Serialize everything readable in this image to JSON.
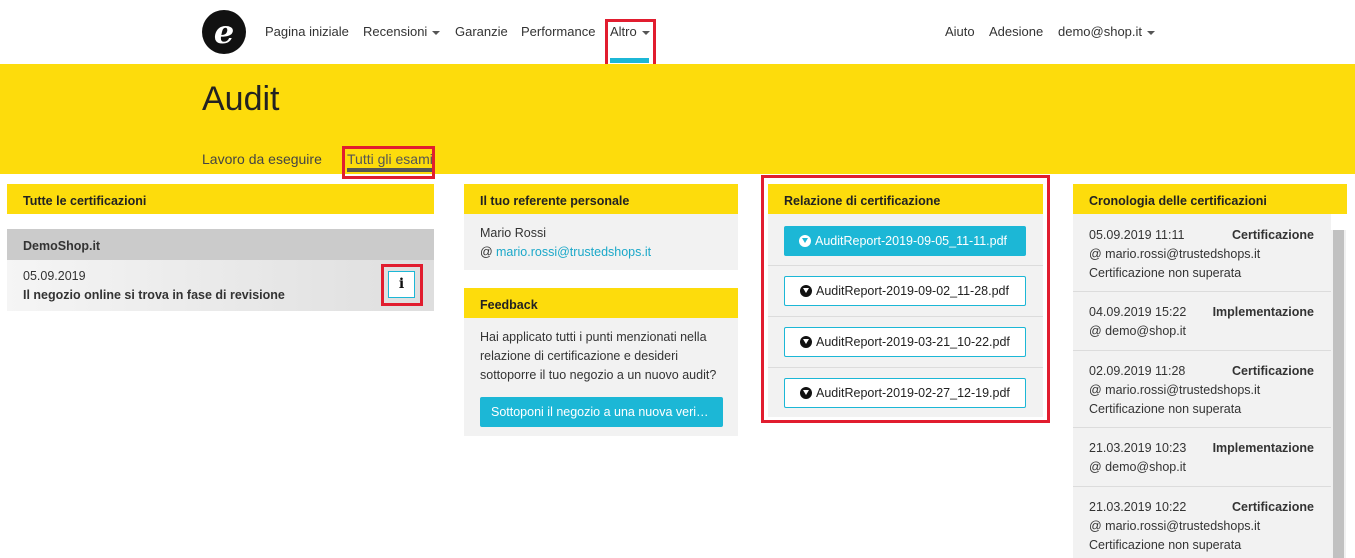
{
  "nav": {
    "logo_letter": "e",
    "items": [
      {
        "label": "Pagina iniziale"
      },
      {
        "label": "Recensioni"
      },
      {
        "label": "Garanzie"
      },
      {
        "label": "Performance"
      },
      {
        "label": "Altro"
      }
    ],
    "right": [
      {
        "label": "Aiuto"
      },
      {
        "label": "Adesione"
      },
      {
        "label": "demo@shop.it"
      }
    ]
  },
  "header": {
    "title": "Audit",
    "tabs": [
      {
        "label": "Lavoro da eseguire"
      },
      {
        "label": "Tutti gli esami"
      }
    ]
  },
  "certifications": {
    "title": "Tutte le certificazioni",
    "shop_name": "DemoShop.it",
    "date": "05.09.2019",
    "status": "Il negozio online si trova in fase di revisione",
    "info_icon": "i"
  },
  "contact": {
    "title": "Il tuo referente personale",
    "name": "Mario Rossi",
    "at": "@",
    "email": "mario.rossi@trustedshops.it"
  },
  "feedback": {
    "title": "Feedback",
    "text_lines": [
      "Hai applicato tutti i punti menzionati nella",
      "relazione di certificazione e desideri",
      "sottoporre il tuo negozio a un nuovo audit?"
    ],
    "button": "Sottoponi il negozio a una nuova veri…"
  },
  "report": {
    "title": "Relazione di certificazione",
    "files": [
      {
        "label": "AuditReport-2019-09-05_11-11.pdf"
      },
      {
        "label": "AuditReport-2019-09-02_11-28.pdf"
      },
      {
        "label": "AuditReport-2019-03-21_10-22.pdf"
      },
      {
        "label": "AuditReport-2019-02-27_12-19.pdf"
      }
    ]
  },
  "history": {
    "title": "Cronologia delle certificazioni",
    "entries": [
      {
        "date": "05.09.2019 11:11",
        "type": "Certificazione",
        "user": "@ mario.rossi@trustedshops.it",
        "result": "Certificazione non superata"
      },
      {
        "date": "04.09.2019 15:22",
        "type": "Implementazione",
        "user": "@ demo@shop.it",
        "result": ""
      },
      {
        "date": "02.09.2019 11:28",
        "type": "Certificazione",
        "user": "@ mario.rossi@trustedshops.it",
        "result": "Certificazione non superata"
      },
      {
        "date": "21.03.2019 10:23",
        "type": "Implementazione",
        "user": "@ demo@shop.it",
        "result": ""
      },
      {
        "date": "21.03.2019 10:22",
        "type": "Certificazione",
        "user": "@ mario.rossi@trustedshops.it",
        "result": "Certificazione non superata"
      }
    ]
  },
  "colors": {
    "accent_yellow": "#fddc0c",
    "accent_cyan": "#1cb7d6",
    "highlight_red": "#e11d2f"
  }
}
